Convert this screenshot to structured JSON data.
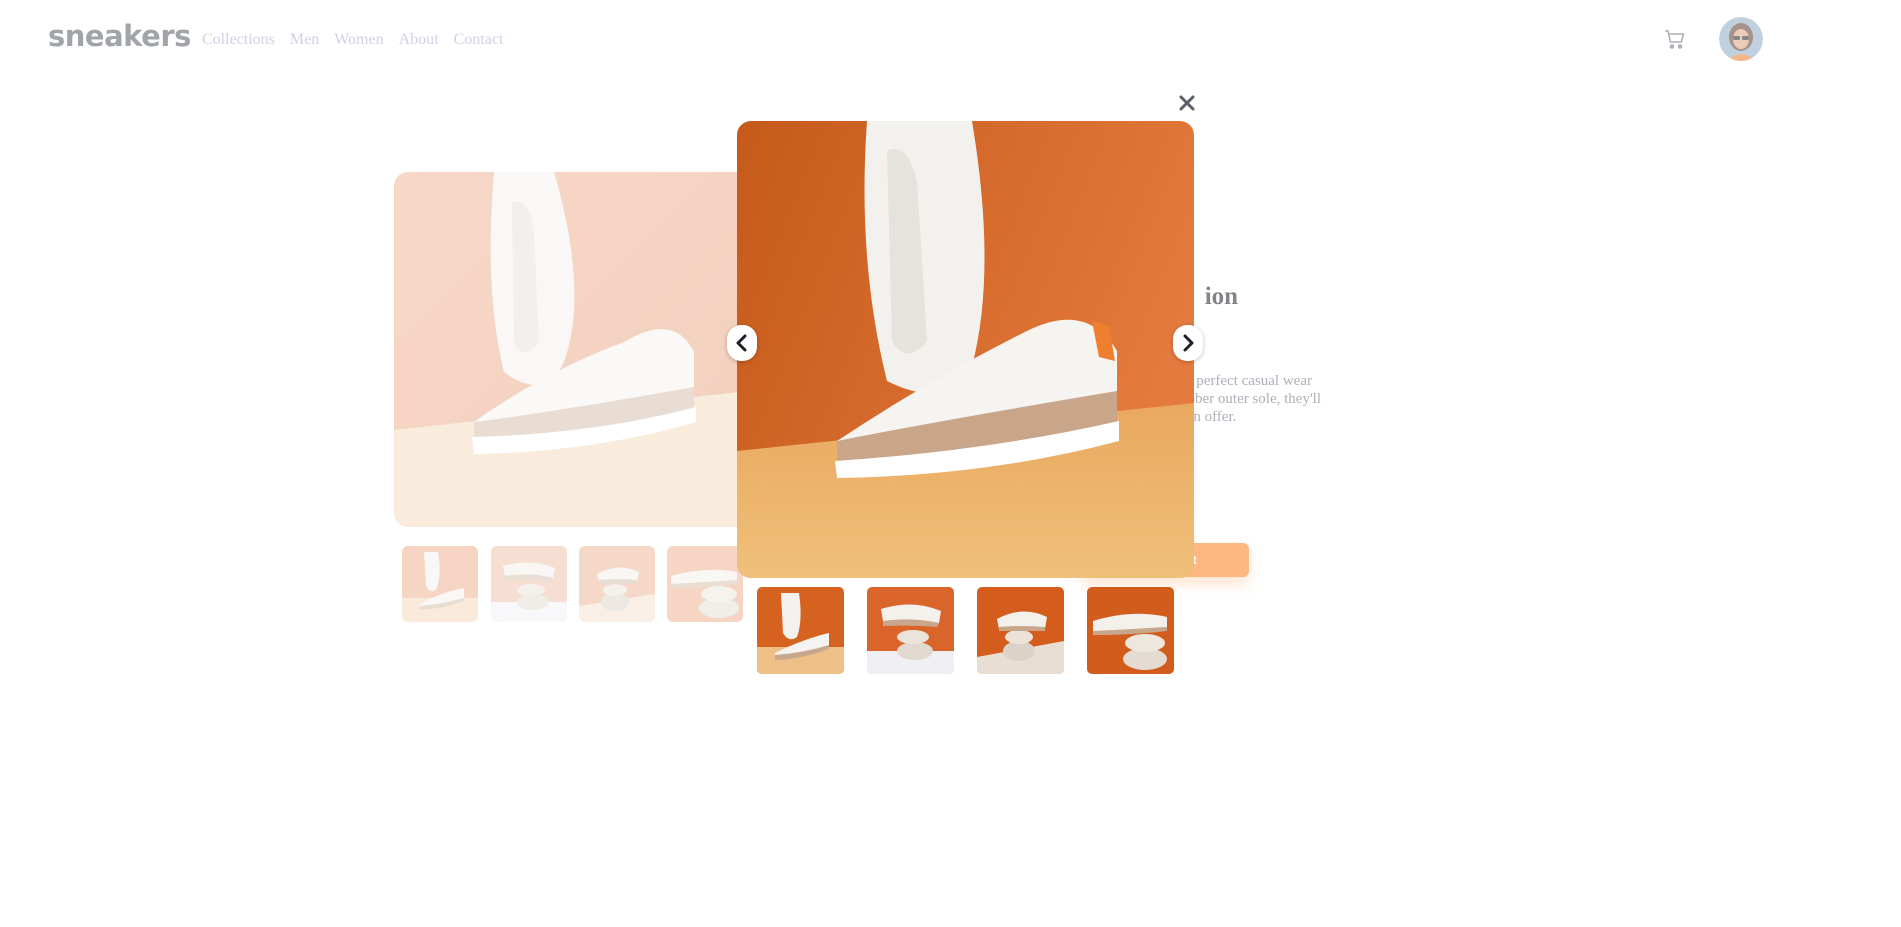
{
  "header": {
    "logo": "sneakers",
    "nav": [
      "Collections",
      "Men",
      "Women",
      "About",
      "Contact"
    ],
    "cart_icon": "cart-icon",
    "avatar": "user-avatar"
  },
  "product": {
    "title_visible": "ion",
    "description_visible": "ur perfect casual wear\nubber outer sole, they'll\ncan offer.",
    "add_to_cart_visible": "art"
  },
  "lightbox": {
    "close_icon": "close-icon",
    "prev_icon": "chevron-left-icon",
    "next_icon": "chevron-right-icon",
    "thumbnail_count": 4,
    "selected_index": 0
  },
  "colors": {
    "accent": "#ff7d1a",
    "nav_text": "#b7a2d2",
    "logo": "#555a63",
    "page_photo_bg": "#efb394",
    "lightbox_photo_bg": "#d9641c"
  }
}
